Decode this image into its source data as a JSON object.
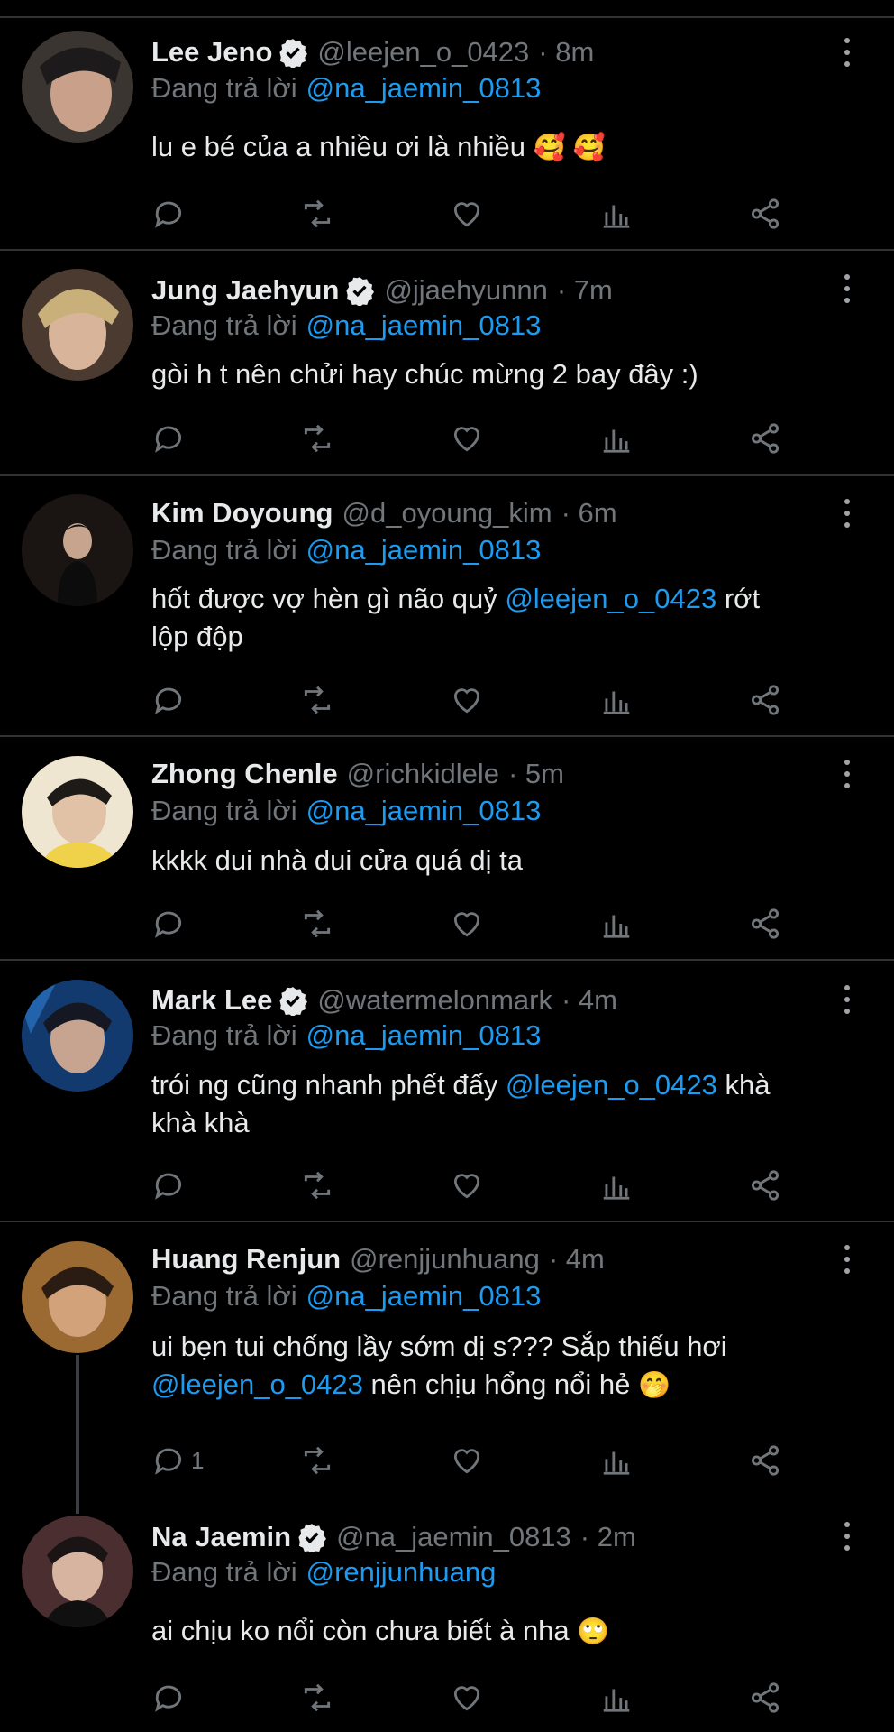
{
  "reply_prefix": "Đang trả lời",
  "tweets": [
    {
      "name": "Lee Jeno",
      "verified": true,
      "handle": "@leejen_o_0423",
      "time": "· 8m",
      "reply_to": "@na_jaemin_0813",
      "text": "lu e bé của a nhiều ơi là nhiều",
      "text_emoji": "🥰 🥰",
      "reply_count": "",
      "avatar_color": "#5a4f4a"
    },
    {
      "name": "Jung Jaehyun",
      "verified": true,
      "handle": "@jjaehyunnn",
      "time": "· 7m",
      "reply_to": "@na_jaemin_0813",
      "text": "gòi h t nên chửi hay chúc mừng 2 bay đây :)",
      "reply_count": "",
      "avatar_color": "#6e5b4c"
    },
    {
      "name": "Kim Doyoung",
      "verified": false,
      "handle": "@d_oyoung_kim",
      "time": "· 6m",
      "reply_to": "@na_jaemin_0813",
      "text_a": "hốt được vợ hèn gì não quỷ",
      "mention": "@leejen_o_0423",
      "text_b": "rớt",
      "text_c": "lộp độp",
      "reply_count": "",
      "avatar_color": "#2a2422"
    },
    {
      "name": "Zhong Chenle",
      "verified": false,
      "handle": "@richkidlele",
      "time": "· 5m",
      "reply_to": "@na_jaemin_0813",
      "text": "kkkk dui nhà dui cửa quá dị ta",
      "reply_count": "",
      "avatar_color": "#d9c9a8"
    },
    {
      "name": "Mark Lee",
      "verified": true,
      "handle": "@watermelonmark",
      "time": "· 4m",
      "reply_to": "@na_jaemin_0813",
      "text_a": "trói ng cũng nhanh phết đấy",
      "mention": "@leejen_o_0423",
      "text_b": "khà",
      "text_c": "khà khà",
      "reply_count": "",
      "avatar_color": "#1f4f8a"
    },
    {
      "name": "Huang Renjun",
      "verified": false,
      "handle": "@renjjunhuang",
      "time": "· 4m",
      "reply_to": "@na_jaemin_0813",
      "text_a": "ui bẹn tui chống lầy sớm dị s??? Sắp thiếu hơi",
      "mention": "@leejen_o_0423",
      "text_b": "nên chịu hổng nổi hẻ",
      "text_emoji": "🤭",
      "reply_count": "1",
      "avatar_color": "#8a5a2c"
    },
    {
      "name": "Na Jaemin",
      "verified": true,
      "handle": "@na_jaemin_0813",
      "time": "· 2m",
      "reply_to": "@renjjunhuang",
      "text": "ai chịu ko nổi còn chưa biết à nha",
      "text_emoji": "🙄",
      "reply_count": "",
      "avatar_color": "#5a3a3a"
    }
  ]
}
